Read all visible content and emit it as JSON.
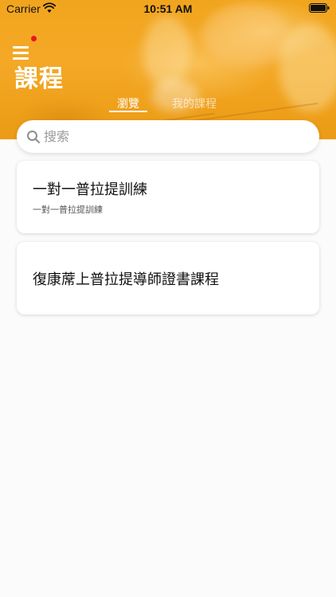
{
  "status_bar": {
    "carrier": "Carrier",
    "time": "10:51 AM"
  },
  "header": {
    "title": "課程",
    "menu_icon": "hamburger-menu-icon",
    "notification_color": "#e8161b",
    "accent_color": "#f4a826"
  },
  "tabs": [
    {
      "label": "瀏覽",
      "active": true
    },
    {
      "label": "我的課程",
      "active": false
    }
  ],
  "search": {
    "placeholder": "搜索",
    "value": ""
  },
  "courses": [
    {
      "title": "一對一普拉提訓練",
      "subtitle": "一對一普拉提訓練"
    },
    {
      "title": "復康蓆上普拉提導師證書課程",
      "subtitle": ""
    }
  ]
}
